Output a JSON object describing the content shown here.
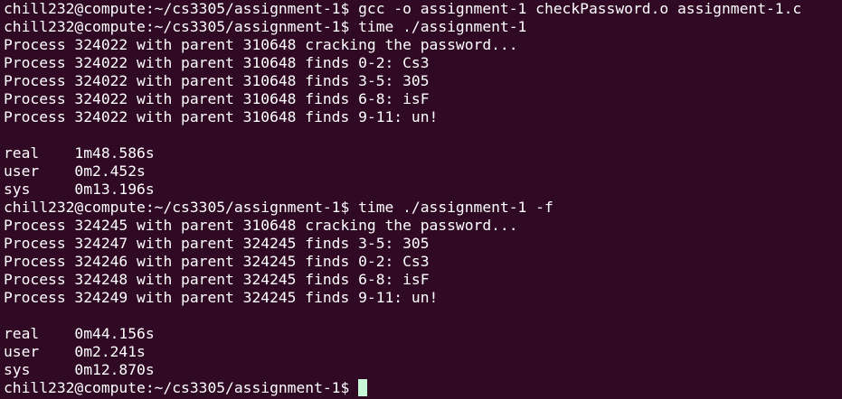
{
  "terminal": {
    "prompt": "chill232@compute:~/cs3305/assignment-1$",
    "lines": [
      {
        "type": "prompt",
        "command": " gcc -o assignment-1 checkPassword.o assignment-1.c"
      },
      {
        "type": "prompt",
        "command": " time ./assignment-1"
      },
      {
        "type": "output",
        "text": "Process 324022 with parent 310648 cracking the password..."
      },
      {
        "type": "output",
        "text": "Process 324022 with parent 310648 finds 0-2: Cs3"
      },
      {
        "type": "output",
        "text": "Process 324022 with parent 310648 finds 3-5: 305"
      },
      {
        "type": "output",
        "text": "Process 324022 with parent 310648 finds 6-8: isF"
      },
      {
        "type": "output",
        "text": "Process 324022 with parent 310648 finds 9-11: un!"
      },
      {
        "type": "output",
        "text": ""
      },
      {
        "type": "output",
        "text": "real\t1m48.586s"
      },
      {
        "type": "output",
        "text": "user\t0m2.452s"
      },
      {
        "type": "output",
        "text": "sys\t0m13.196s"
      },
      {
        "type": "prompt",
        "command": " time ./assignment-1 -f"
      },
      {
        "type": "output",
        "text": "Process 324245 with parent 310648 cracking the password..."
      },
      {
        "type": "output",
        "text": "Process 324247 with parent 324245 finds 3-5: 305"
      },
      {
        "type": "output",
        "text": "Process 324246 with parent 324245 finds 0-2: Cs3"
      },
      {
        "type": "output",
        "text": "Process 324248 with parent 324245 finds 6-8: isF"
      },
      {
        "type": "output",
        "text": "Process 324249 with parent 324245 finds 9-11: un!"
      },
      {
        "type": "output",
        "text": ""
      },
      {
        "type": "output",
        "text": "real\t0m44.156s"
      },
      {
        "type": "output",
        "text": "user\t0m2.241s"
      },
      {
        "type": "output",
        "text": "sys\t0m12.870s"
      },
      {
        "type": "prompt",
        "command": " "
      }
    ],
    "colors": {
      "background": "#300a24",
      "text": "#ffffff",
      "cursor": "#c8f7d8"
    }
  }
}
